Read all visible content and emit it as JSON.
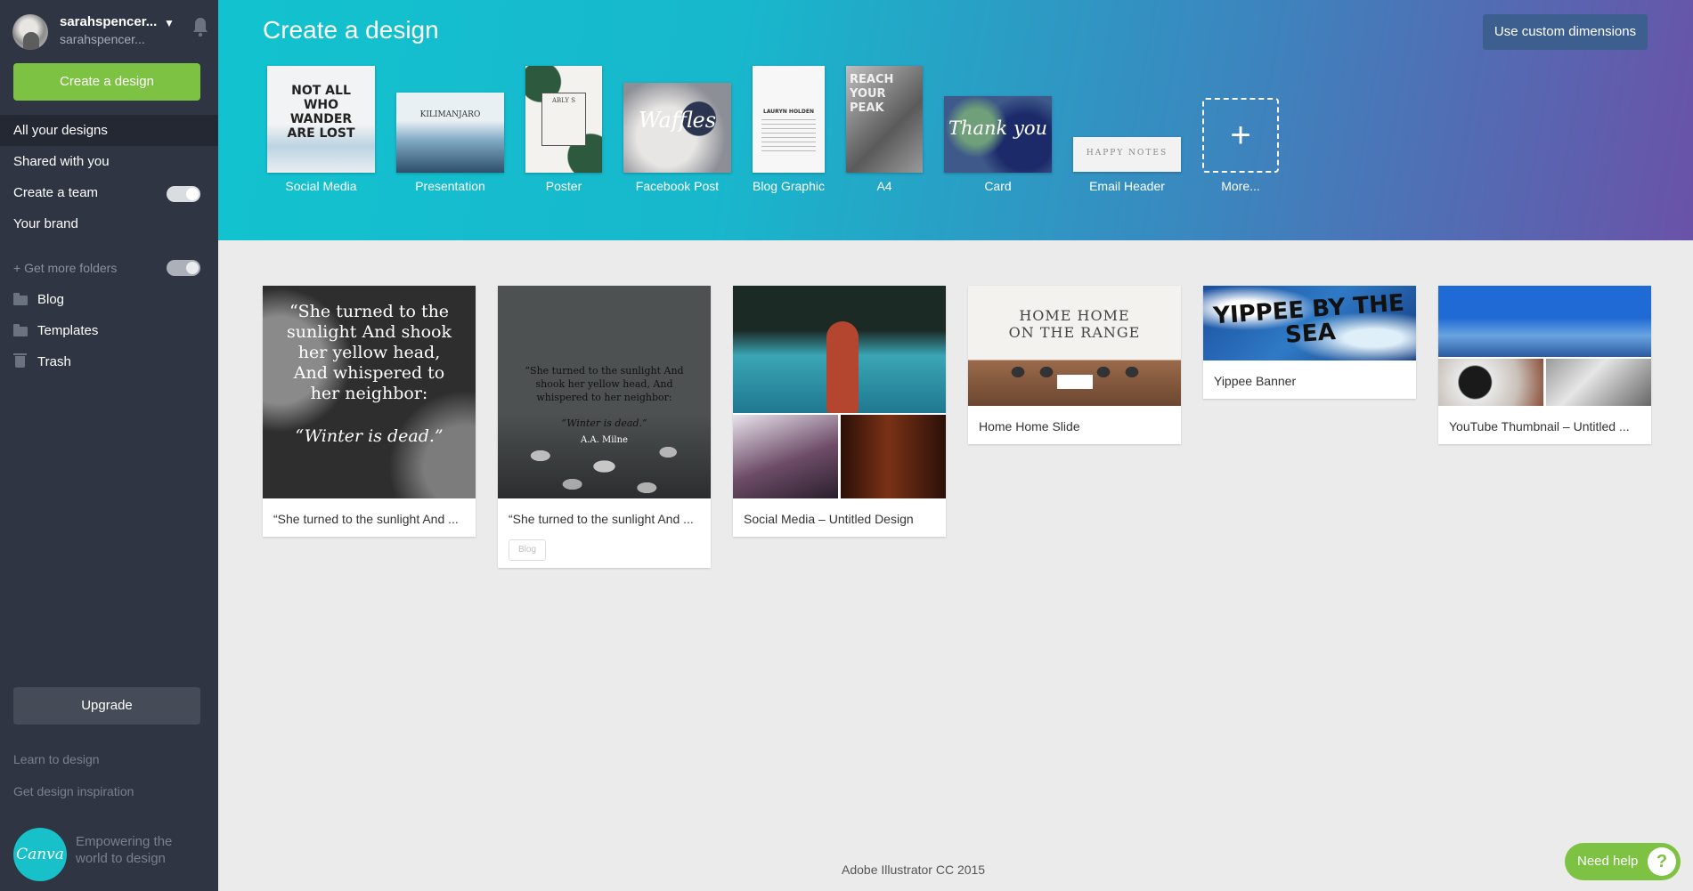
{
  "sidebar": {
    "user": {
      "name": "sarahspencer...",
      "sub": "sarahspencer..."
    },
    "create_label": "Create a design",
    "nav": [
      {
        "label": "All your designs"
      },
      {
        "label": "Shared with you"
      },
      {
        "label": "Create a team"
      },
      {
        "label": "Your brand"
      }
    ],
    "more_folders": "+ Get more folders",
    "folders": [
      {
        "label": "Blog"
      },
      {
        "label": "Templates"
      },
      {
        "label": "Trash"
      }
    ],
    "upgrade_label": "Upgrade",
    "learn": "Learn to design",
    "inspiration": "Get design inspiration",
    "logo_text": "Canva",
    "tagline": "Empowering the world to design"
  },
  "header": {
    "title": "Create a design",
    "custom_label": "Use custom dimensions",
    "templates": [
      {
        "label": "Social Media",
        "thumb_text": "NOT ALL WHO WANDER ARE LOST"
      },
      {
        "label": "Presentation",
        "thumb_text": "KILIMANJARO"
      },
      {
        "label": "Poster",
        "thumb_text": "ABLY S"
      },
      {
        "label": "Facebook Post",
        "thumb_text": "Waffles"
      },
      {
        "label": "Blog Graphic",
        "thumb_text": "LAURYN HOLDEN"
      },
      {
        "label": "A4",
        "thumb_text": "REACH YOUR PEAK"
      },
      {
        "label": "Card",
        "thumb_text": "Thank you"
      },
      {
        "label": "Email Header",
        "thumb_text": "HAPPY NOTES"
      },
      {
        "label": "More..."
      }
    ]
  },
  "designs": [
    {
      "caption": "“She turned to the sunlight And ...",
      "quote": "“She turned to the sunlight And shook her yellow head, And whispered to her neighbor:",
      "quote_em": "“Winter is dead.”"
    },
    {
      "caption": "“She turned to the sunlight And ...",
      "tag": "Blog",
      "quote": "“She turned to the sunlight And shook her yellow head, And whispered to her neighbor:",
      "quote_em": "“Winter is dead.”",
      "author": "A.A. Milne"
    },
    {
      "caption": "Social Media – Untitled Design"
    },
    {
      "caption": "Home Home Slide",
      "headline": "HOME HOME ON THE RANGE"
    },
    {
      "caption": "Yippee Banner",
      "headline": "YIPPEE BY THE SEA"
    },
    {
      "caption": "YouTube Thumbnail – Untitled ..."
    }
  ],
  "footer_app": "Adobe Illustrator CC 2015",
  "help_label": "Need help",
  "help_icon": "?",
  "colors": {
    "sidebar": "#2f3542",
    "accent_green": "#7dc242",
    "header_start": "#12c3cf",
    "header_end": "#6a52a8",
    "teal_logo": "#18c1c9"
  }
}
